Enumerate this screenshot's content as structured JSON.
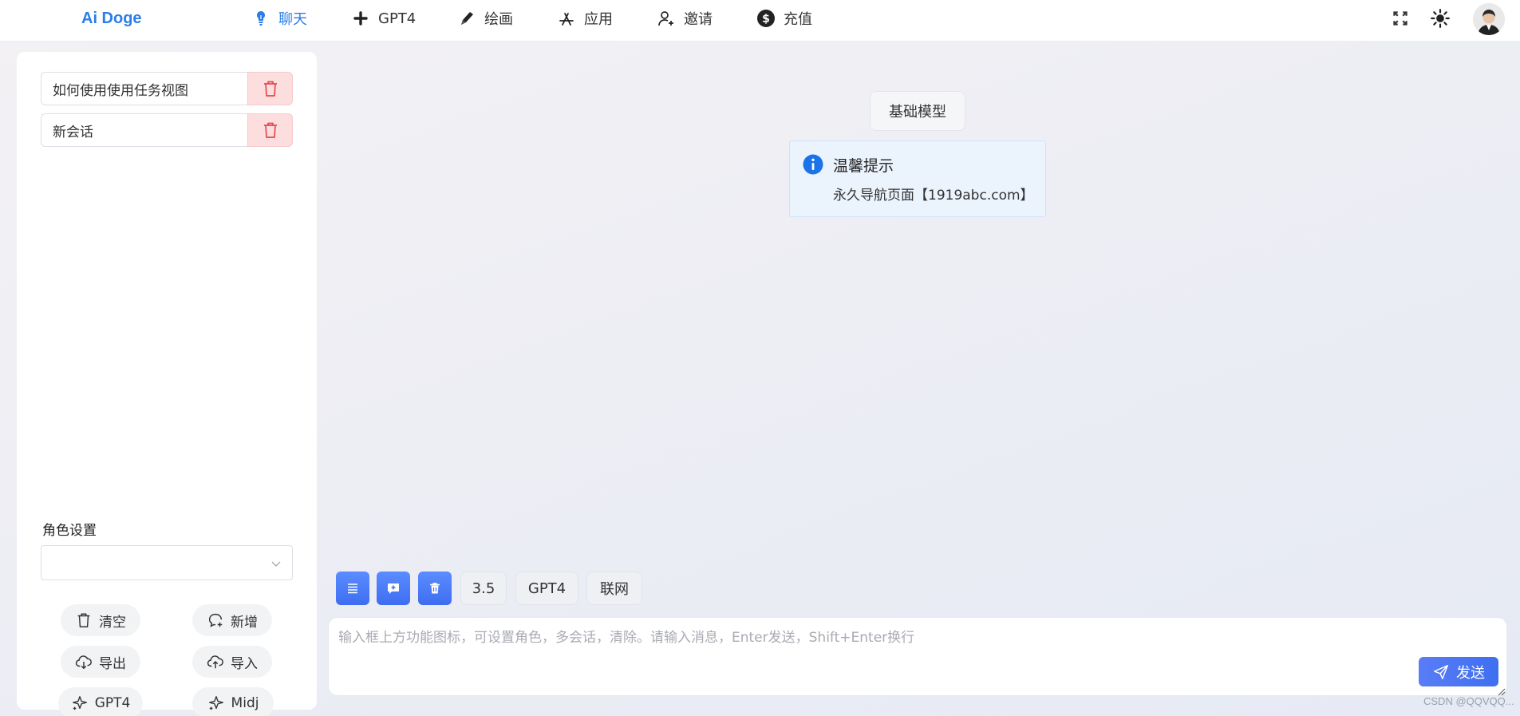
{
  "app": {
    "name": "Ai Doge",
    "brand_color": "#2b7de9"
  },
  "nav": {
    "items": [
      {
        "label": "聊天",
        "icon": "lightbulb-icon",
        "active": true
      },
      {
        "label": "GPT4",
        "icon": "plus-icon",
        "active": false
      },
      {
        "label": "绘画",
        "icon": "pencil-icon",
        "active": false
      },
      {
        "label": "应用",
        "icon": "app-store-icon",
        "active": false
      },
      {
        "label": "邀请",
        "icon": "user-plus-icon",
        "active": false
      },
      {
        "label": "充值",
        "icon": "dollar-icon",
        "active": false
      }
    ],
    "right_icons": [
      "fullscreen-icon",
      "sun-icon",
      "avatar"
    ]
  },
  "sidebar": {
    "sessions": [
      {
        "title": "如何使用使用任务视图"
      },
      {
        "title": "新会话"
      }
    ],
    "role_label": "角色设置",
    "role_value": "",
    "buttons": [
      {
        "label": "清空",
        "icon": "trash-icon"
      },
      {
        "label": "新增",
        "icon": "chat-plus-icon"
      },
      {
        "label": "导出",
        "icon": "cloud-download-icon"
      },
      {
        "label": "导入",
        "icon": "cloud-upload-icon"
      },
      {
        "label": "GPT4",
        "icon": "sparkle-icon"
      },
      {
        "label": "Midj",
        "icon": "sparkle-icon"
      }
    ]
  },
  "main": {
    "model_tag": "基础模型",
    "notice": {
      "title": "温馨提示",
      "body": "永久导航页面【1919abc.com】"
    },
    "toolbar": {
      "icon_buttons": [
        "list-icon",
        "message-plus-icon",
        "trash-icon"
      ],
      "text_buttons": [
        "3.5",
        "GPT4",
        "联网"
      ]
    },
    "input": {
      "placeholder": "输入框上方功能图标，可设置角色，多会话，清除。请输入消息，Enter发送，Shift+Enter换行",
      "value": ""
    },
    "send_label": "发送"
  },
  "watermark": "CSDN @QQVQQ..."
}
